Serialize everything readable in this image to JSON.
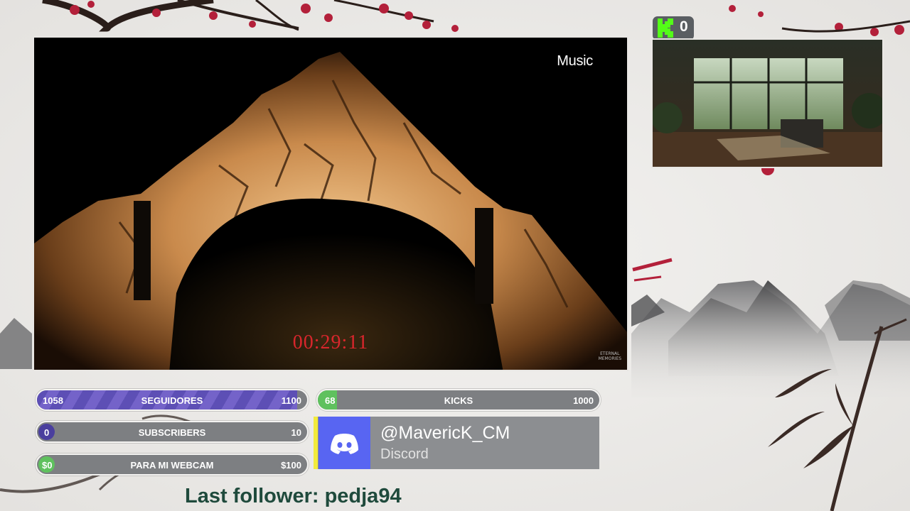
{
  "player": {
    "watermark": "Music",
    "watermark_icon": "apple-icon",
    "timer": "00:29:11",
    "corner_logo_line1": "ETERNAL",
    "corner_logo_line2": "MEMORIES"
  },
  "kick_badge": {
    "icon": "kick-logo-icon",
    "count": "0",
    "accent": "#53fc18"
  },
  "goals": [
    {
      "id": "followers",
      "label": "SEGUIDORES",
      "current": "1058",
      "target": "1100",
      "progress": 0.962,
      "color": "#6b5bc2"
    },
    {
      "id": "kicks",
      "label": "KICKS",
      "current": "68",
      "target": "1000",
      "progress": 0.068,
      "color": "#5fc15e"
    },
    {
      "id": "subscribers",
      "label": "SUBSCRIBERS",
      "current": "0",
      "target": "10",
      "progress": 0.0,
      "color": "#4a3f9e"
    },
    {
      "id": "webcam",
      "label": "PARA MI WEBCAM",
      "current": "$0",
      "target": "$100",
      "progress": 0.0,
      "color": "#5fc15e"
    }
  ],
  "discord": {
    "handle": "@MavericK_CM",
    "platform": "Discord",
    "icon": "discord-icon",
    "brand_color": "#5865f2"
  },
  "last_follower": {
    "text": "Last follower: pedja94"
  }
}
